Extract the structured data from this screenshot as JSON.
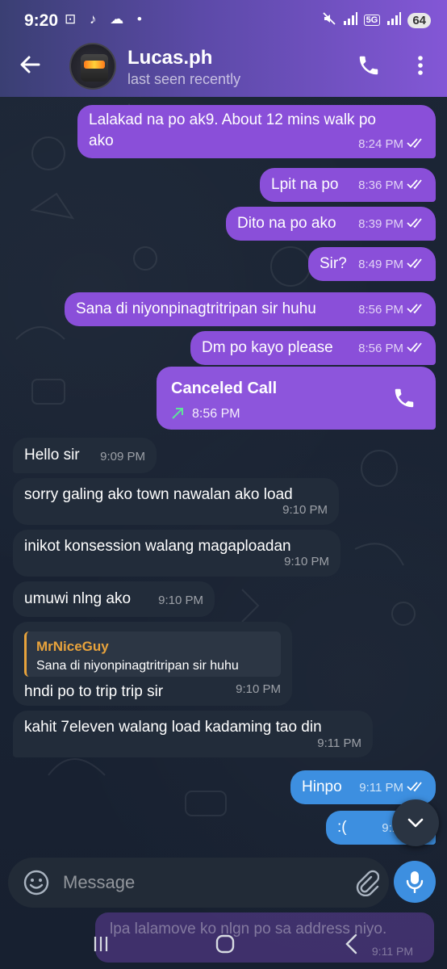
{
  "status_bar": {
    "time": "9:20",
    "left_icons": "⊡ ♪ ☁ •",
    "network": "5G",
    "battery": "64"
  },
  "header": {
    "contact_name": "Lucas.ph",
    "contact_status": "last seen recently"
  },
  "messages": [
    {
      "dir": "out",
      "text_line1": "Lalakad na po ak9. About 12 mins walk  po",
      "text_line2": "ako",
      "time": "8:24 PM"
    },
    {
      "dir": "out",
      "text": "Lpit na po",
      "time": "8:36 PM"
    },
    {
      "dir": "out",
      "text": "Dito na po ako",
      "time": "8:39 PM"
    },
    {
      "dir": "out",
      "text": "Sir?",
      "time": "8:49 PM"
    },
    {
      "dir": "out",
      "text": "Sana di niyonpinagtritripan sir huhu",
      "time": "8:56 PM"
    },
    {
      "dir": "out",
      "text": "Dm po kayo please",
      "time": "8:56 PM"
    },
    {
      "dir": "out",
      "kind": "call",
      "title": "Canceled Call",
      "time": "8:56 PM"
    },
    {
      "dir": "in",
      "text": "Hello sir",
      "time": "9:09 PM"
    },
    {
      "dir": "in",
      "text": "sorry galing ako town nawalan ako load",
      "time": "9:10 PM"
    },
    {
      "dir": "in",
      "text": "inikot konsession walang magaploadan",
      "time": "9:10 PM"
    },
    {
      "dir": "in",
      "text": "umuwi nlng ako",
      "time": "9:10 PM"
    },
    {
      "dir": "in",
      "kind": "reply",
      "reply_name": "MrNiceGuy",
      "reply_text": "Sana di niyonpinagtritripan sir huhu",
      "text": "hndi po to trip trip sir",
      "time": "9:10 PM"
    },
    {
      "dir": "in",
      "text": "kahit 7eleven walang load kadaming tao din",
      "time": "9:11 PM"
    },
    {
      "dir": "out",
      "text": "Hinpo",
      "time": "9:11 PM"
    },
    {
      "dir": "out",
      "text": ":(",
      "time": "9:11 PM"
    }
  ],
  "composer": {
    "placeholder": "Message"
  },
  "ghost_bubble": {
    "text": "lpa lalamove ko nlgn po sa address niyo.",
    "time": "9:11 PM"
  },
  "colors": {
    "outgoing": "#8a4fd9",
    "incoming": "#222c3a",
    "accent": "#3d8fe0",
    "reply_accent": "#e8a33c"
  }
}
